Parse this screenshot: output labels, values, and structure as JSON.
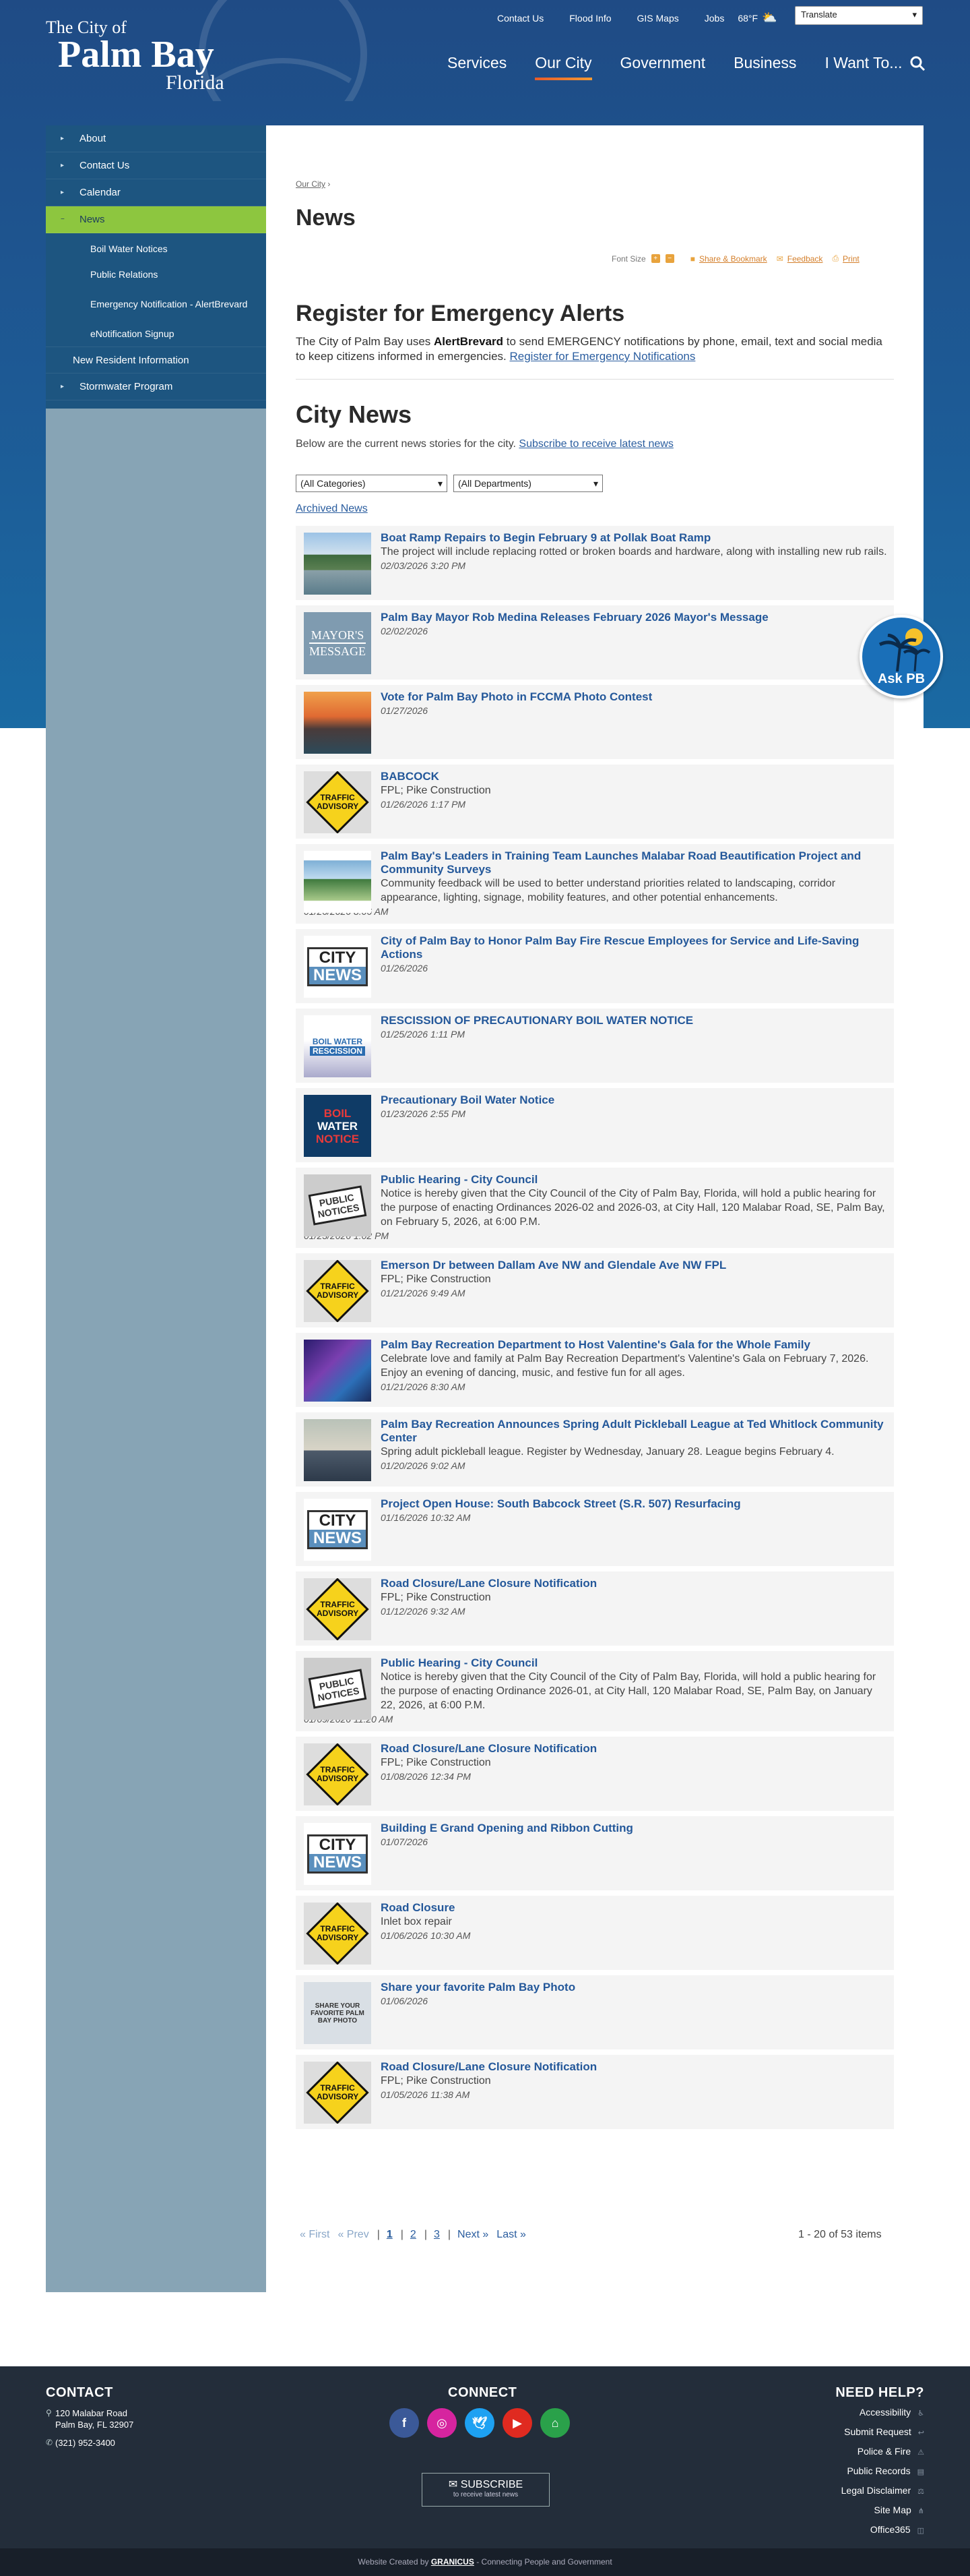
{
  "header": {
    "logo_line1": "The City of",
    "logo_line2": "Palm Bay",
    "logo_line3": "Florida",
    "utility_links": [
      "Contact Us",
      "Flood Info",
      "GIS Maps",
      "Jobs"
    ],
    "weather": "68°F",
    "translate_label": "Translate",
    "nav": [
      "Services",
      "Our City",
      "Government",
      "Business",
      "I Want To..."
    ],
    "nav_active": "Our City"
  },
  "sidebar": {
    "items": [
      {
        "label": "About"
      },
      {
        "label": "Contact Us"
      },
      {
        "label": "Calendar"
      },
      {
        "label": "News",
        "active": true
      }
    ],
    "subitems": [
      "Boil Water Notices",
      "Public Relations",
      "Emergency Notification - AlertBrevard",
      "eNotification Signup"
    ],
    "after_items": [
      "New Resident Information",
      "Stormwater Program"
    ]
  },
  "content": {
    "breadcrumb": "Our City",
    "page_title": "News",
    "tools": {
      "font_size": "Font Size",
      "share": "Share & Bookmark",
      "feedback": "Feedback",
      "print": "Print"
    },
    "alert_heading": "Register for Emergency Alerts",
    "alert_text_a": "The City of Palm Bay uses ",
    "alert_text_bold": "AlertBrevard",
    "alert_text_b": " to send EMERGENCY notifications by phone, email, text and social media to keep citizens informed in emergencies. ",
    "alert_link": "Register for Emergency Notifications",
    "news_heading": "City News",
    "news_intro": "Below are the current news stories for the city. ",
    "news_intro_link": "Subscribe to receive latest news",
    "filter_categories": "(All Categories)",
    "filter_departments": "(All Departments)",
    "archived": "Archived News"
  },
  "news": [
    {
      "title": "Boat Ramp Repairs to Begin February 9 at Pollak Boat Ramp",
      "desc": "The project will include replacing rotted or broken boards and hardware, along with installing new rub rails.",
      "date": "02/03/2026 3:20 PM",
      "thumb": "photo-ramp"
    },
    {
      "title": "Palm Bay Mayor Rob Medina Releases February 2026 Mayor's Message",
      "desc": "",
      "date": "02/02/2026",
      "thumb": "mayors-message"
    },
    {
      "title": "Vote for Palm Bay Photo in FCCMA Photo Contest",
      "desc": "",
      "date": "01/27/2026",
      "thumb": "photo-sunset"
    },
    {
      "title": "BABCOCK",
      "desc": "FPL; Pike Construction",
      "date": "01/26/2026 1:17 PM",
      "thumb": "traffic-advisory"
    },
    {
      "title": "Palm Bay's Leaders in Training Team Launches Malabar Road Beautification Project and Community Surveys",
      "desc": "Community feedback will be used to better understand priorities related to landscaping, corridor appearance, lighting, signage, mobility features, and other potential enhancements.",
      "date": "01/26/2026 8:06 AM",
      "date_out": true,
      "thumb": "photo-survey"
    },
    {
      "title": "City of Palm Bay to Honor Palm Bay Fire Rescue Employees for Service and Life-Saving Actions",
      "desc": "",
      "date": "01/26/2026",
      "thumb": "city-news"
    },
    {
      "title": "RESCISSION OF PRECAUTIONARY BOIL WATER NOTICE",
      "desc": "",
      "date": "01/25/2026 1:11 PM",
      "thumb": "boil-rescission"
    },
    {
      "title": "Precautionary Boil Water Notice",
      "desc": "",
      "date": "01/23/2026 2:55 PM",
      "thumb": "boil-notice"
    },
    {
      "title": "Public Hearing - City Council",
      "desc": "Notice is hereby given that the City Council of the City of Palm Bay, Florida, will hold a public hearing for the purpose of enacting Ordinances 2026-02 and 2026-03, at City Hall, 120 Malabar Road, SE, Palm Bay, on February 5, 2026, at 6:00 P.M.",
      "date": "01/23/2026 1:02 PM",
      "date_out": true,
      "thumb": "public-notices"
    },
    {
      "title": "Emerson Dr between Dallam Ave NW and Glendale Ave NW FPL",
      "desc": "FPL; Pike Construction",
      "date": "01/21/2026 9:49 AM",
      "thumb": "traffic-advisory"
    },
    {
      "title": "Palm Bay Recreation Department to Host Valentine's Gala for the Whole Family",
      "desc": "Celebrate love and family at Palm Bay Recreation Department's Valentine's Gala on February 7, 2026. Enjoy an evening of dancing, music, and festive fun for all ages.",
      "date": "01/21/2026 8:30 AM",
      "thumb": "photo-gala"
    },
    {
      "title": "Palm Bay Recreation Announces Spring Adult Pickleball League at Ted Whitlock Community Center",
      "desc": "Spring adult pickleball league. Register by Wednesday, January 28. League begins February 4.",
      "date": "01/20/2026 9:02 AM",
      "thumb": "photo-pickleball"
    },
    {
      "title": "Project Open House: South Babcock Street (S.R. 507) Resurfacing",
      "desc": "",
      "date": "01/16/2026 10:32 AM",
      "thumb": "city-news"
    },
    {
      "title": "Road Closure/Lane Closure Notification",
      "desc": "FPL; Pike Construction",
      "date": "01/12/2026 9:32 AM",
      "thumb": "traffic-advisory"
    },
    {
      "title": "Public Hearing - City Council",
      "desc": "Notice is hereby given that the City Council of the City of Palm Bay, Florida, will hold a public hearing for the purpose of enacting Ordinance 2026-01, at City Hall, 120 Malabar Road, SE, Palm Bay, on January 22, 2026, at 6:00 P.M.",
      "date": "01/09/2026 11:20 AM",
      "date_out": true,
      "thumb": "public-notices"
    },
    {
      "title": "Road Closure/Lane Closure Notification",
      "desc": "FPL; Pike Construction",
      "date": "01/08/2026 12:34 PM",
      "thumb": "traffic-advisory"
    },
    {
      "title": "Building E Grand Opening and Ribbon Cutting",
      "desc": "",
      "date": "01/07/2026",
      "thumb": "city-news"
    },
    {
      "title": "Road Closure",
      "desc": "Inlet box repair",
      "date": "01/06/2026 10:30 AM",
      "thumb": "traffic-advisory"
    },
    {
      "title": "Share your favorite Palm Bay Photo",
      "desc": "",
      "date": "01/06/2026",
      "thumb": "photo-share"
    },
    {
      "title": "Road Closure/Lane Closure Notification",
      "desc": "FPL; Pike Construction",
      "date": "01/05/2026 11:38 AM",
      "thumb": "traffic-advisory"
    }
  ],
  "thumb_text": {
    "traffic": "TRAFFIC ADVISORY",
    "city": "CITY",
    "news": "NEWS",
    "mayor1": "MAYOR'S",
    "mayor2": "MESSAGE",
    "boil1": "BOIL WATER",
    "boil2": "RESCISSION",
    "boil3": "BOIL",
    "boil4": "WATER",
    "boil5": "NOTICE",
    "public1": "PUBLIC",
    "public2": "NOTICES",
    "share": "SHARE YOUR FAVORITE PALM BAY PHOTO"
  },
  "pager": {
    "first": "« First",
    "prev": "« Prev",
    "pages": [
      "1",
      "2",
      "3"
    ],
    "next": "Next »",
    "last": "Last »",
    "count": "1 - 20 of 53 items"
  },
  "ask": {
    "label": "Ask PB"
  },
  "footer": {
    "contact_heading": "CONTACT",
    "address1": "120 Malabar Road",
    "address2": "Palm Bay, FL 32907",
    "phone": "(321) 952-3400",
    "connect_heading": "CONNECT",
    "subscribe": "SUBSCRIBE",
    "subscribe_sub": "to receive latest news",
    "help_heading": "NEED HELP?",
    "help_links": [
      "Accessibility",
      "Submit Request",
      "Police & Fire",
      "Public Records",
      "Legal Disclaimer",
      "Site Map",
      "Office365"
    ],
    "credit_a": "Website Created by ",
    "credit_brand": "GRANICUS",
    "credit_b": " - Connecting People and Government"
  },
  "colors": {
    "primary": "#1d5580",
    "accent": "#8dc63f",
    "link": "#24589a",
    "footer": "#232d3a"
  }
}
